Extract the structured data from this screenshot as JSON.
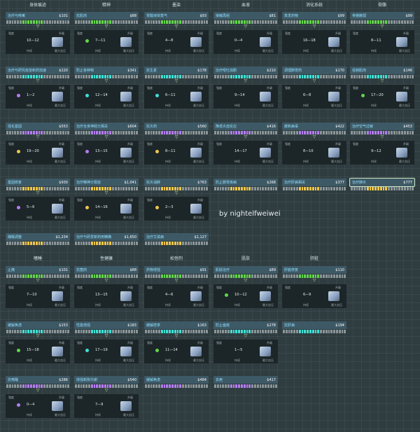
{
  "top_columns": [
    "身体痕迹",
    "精神",
    "墨染",
    "血液",
    "消化系统",
    "骨骼"
  ],
  "bottom_columns": [
    "嗜睡",
    "性健康",
    "松弛剂",
    "肌肤",
    "肝脏"
  ],
  "watermark": "by nightelfweiwei",
  "card_labels": {
    "left": "强度",
    "right": "升级",
    "under_left": "持续",
    "under_right": "最大血压"
  },
  "icon_name": "machine-icon",
  "colors": {
    "green": "#62d64a",
    "cyan": "#3fe0d6",
    "purple": "#b57cf2",
    "yellow": "#f0c64a",
    "grey": "#8a9599"
  },
  "blocks": [
    {
      "name": "治疗与咳嗽",
      "cost": "$101",
      "bar": "green",
      "range": "10—12",
      "chip": "—",
      "sel": false
    },
    {
      "name": "抗肌肉",
      "cost": "$88",
      "bar": "green",
      "range": "7—11",
      "chip": "green",
      "sel": false
    },
    {
      "name": "胃酸液体蒸气",
      "cost": "$93",
      "bar": "green",
      "range": "4—8",
      "chip": "—",
      "sel": false
    },
    {
      "name": "接触再组",
      "cost": "$81",
      "bar": "green",
      "range": "0—4",
      "chip": "—",
      "sel": false
    },
    {
      "name": "蒸发药物",
      "cost": "$99",
      "bar": "green",
      "range": "16—18",
      "chip": "—",
      "sel": false
    },
    {
      "name": "骨骼脆弱",
      "cost": "$99",
      "bar": "green",
      "range": "8—11",
      "chip": "—",
      "sel": false
    },
    {
      "name": "治疗与研究疫苗新药加速",
      "cost": "$220",
      "bar": "cyan",
      "range": "1—2",
      "chip": "purple",
      "sel": false
    },
    {
      "name": "防止各种物",
      "cost": "$341",
      "bar": "cyan",
      "range": "12—14",
      "chip": "cyan",
      "sel": false
    },
    {
      "name": "抗生素",
      "cost": "$178",
      "bar": "cyan",
      "range": "6—11",
      "chip": "cyan",
      "sel": false
    },
    {
      "name": "治疗呕吐加剧",
      "cost": "$210",
      "bar": "cyan",
      "range": "9—14",
      "chip": "—",
      "sel": false
    },
    {
      "name": "调理肠胃药",
      "cost": "$170",
      "bar": "cyan",
      "range": "6—8",
      "chip": "—",
      "sel": false
    },
    {
      "name": "强韧肌肉",
      "cost": "$146",
      "bar": "cyan",
      "range": "17—20",
      "chip": "green",
      "sel": false
    },
    {
      "name": "强化基因",
      "cost": "$553",
      "bar": "purple",
      "range": "19—20",
      "chip": "yellow",
      "sel": false
    },
    {
      "name": "治疗全身神经元相关",
      "cost": "$604",
      "bar": "purple",
      "range": "13—15",
      "chip": "purple",
      "sel": false
    },
    {
      "name": "抗炎药",
      "cost": "$560",
      "bar": "purple",
      "range": "8—11",
      "chip": "yellow",
      "sel": false
    },
    {
      "name": "降低炎症反应",
      "cost": "$416",
      "bar": "purple",
      "range": "14—17",
      "chip": "—",
      "sel": false
    },
    {
      "name": "缓和病毒",
      "cost": "$422",
      "bar": "purple",
      "range": "8—10",
      "chip": "—",
      "sel": false
    },
    {
      "name": "治疗空气过敏",
      "cost": "$453",
      "bar": "purple",
      "range": "9—12",
      "chip": "—",
      "sel": false
    },
    {
      "name": "基因修复",
      "cost": "$930",
      "bar": "yellow",
      "range": "5—6",
      "chip": "purple",
      "sel": false
    },
    {
      "name": "治疗精神分裂症",
      "cost": "$1,041",
      "bar": "yellow",
      "range": "14—16",
      "chip": "yellow",
      "sel": false
    },
    {
      "name": "抗炎消肿",
      "cost": "$763",
      "bar": "yellow",
      "range": "2—3",
      "chip": "yellow",
      "sel": false
    },
    {
      "name": "防止肠胃疾病",
      "cost": "$268",
      "bar": "yellow",
      "range": "",
      "chip": "",
      "sel": false
    },
    {
      "name": "治疗肝病相关",
      "cost": "$377",
      "bar": "yellow",
      "range": "",
      "chip": "",
      "sel": false
    },
    {
      "name": "治疗肺炎",
      "cost": "$777",
      "bar": "yellow",
      "range": "",
      "chip": "",
      "sel": true
    },
    {
      "name": "睡眠调整",
      "cost": "$1,234",
      "bar": "yellow",
      "range": "",
      "chip": "",
      "sel": false
    },
    {
      "name": "治疗与研发新药用精确",
      "cost": "$1,650",
      "bar": "yellow",
      "range": "",
      "chip": "",
      "sel": false
    },
    {
      "name": "治疗艾滋病",
      "cost": "$1,127",
      "bar": "yellow",
      "range": "",
      "chip": "",
      "sel": false
    },
    {
      "name": "止痛",
      "cost": "$101",
      "bar": "green",
      "range": "7—10",
      "chip": "—",
      "sel": false
    },
    {
      "name": "抗菌药",
      "cost": "$88",
      "bar": "green",
      "range": "13—15",
      "chip": "—",
      "sel": false
    },
    {
      "name": "药物增强",
      "cost": "$91",
      "bar": "green",
      "range": "4—6",
      "chip": "—",
      "sel": false
    },
    {
      "name": "肌肤治疗",
      "cost": "$89",
      "bar": "green",
      "range": "10—12",
      "chip": "green",
      "sel": false
    },
    {
      "name": "肝脏修复",
      "cost": "$110",
      "bar": "green",
      "range": "6—9",
      "chip": "—",
      "sel": false
    },
    {
      "name": "缓解焦虑",
      "cost": "$153",
      "bar": "cyan",
      "range": "15—18",
      "chip": "green",
      "sel": false
    },
    {
      "name": "性能增强",
      "cost": "$183",
      "bar": "cyan",
      "range": "17—19",
      "chip": "cyan",
      "sel": false
    },
    {
      "name": "缓解痉挛",
      "cost": "$163",
      "bar": "cyan",
      "range": "11—14",
      "chip": "green",
      "sel": false
    },
    {
      "name": "防止痤疮",
      "cost": "$278",
      "bar": "cyan",
      "range": "1—5",
      "chip": "—",
      "sel": false
    },
    {
      "name": "抗肝病",
      "cost": "$194",
      "bar": "cyan",
      "range": "",
      "chip": "",
      "sel": false
    },
    {
      "name": "抗嗜睡",
      "cost": "$286",
      "bar": "purple",
      "range": "0—4",
      "chip": "purple",
      "sel": false
    },
    {
      "name": "增强新陈代谢",
      "cost": "$540",
      "bar": "purple",
      "range": "7—9",
      "chip": "—",
      "sel": false
    },
    {
      "name": "缓解焦虑",
      "cost": "$484",
      "bar": "purple",
      "range": "",
      "chip": "",
      "sel": false
    },
    {
      "name": "去疤",
      "cost": "$417",
      "bar": "purple",
      "range": "",
      "chip": "",
      "sel": false
    }
  ]
}
